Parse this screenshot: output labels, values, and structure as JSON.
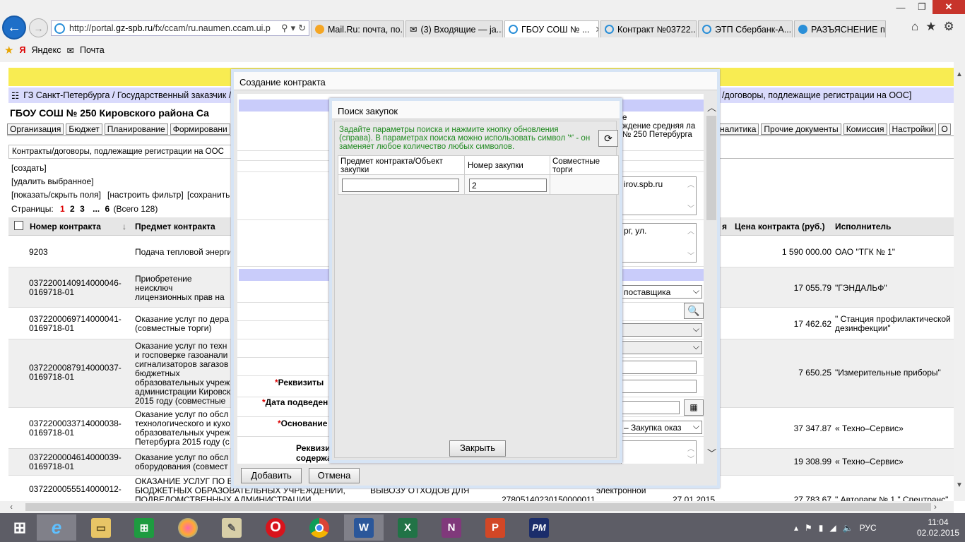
{
  "browser": {
    "url_prefix": "http://portal.",
    "url_domain": "gz-spb.ru",
    "url_rest": "/fx/ccam/ru.naumen.ccam.ui.p",
    "tabs": [
      {
        "label": "Mail.Ru: почта, по...",
        "color": "#f5a623"
      },
      {
        "label": "(3) Входящие — ja...",
        "color": "#444"
      },
      {
        "label": "ГБОУ СОШ № ...",
        "color": "#2a8fd8"
      },
      {
        "label": "Контракт №03722...",
        "color": "#2a8fd8"
      },
      {
        "label": "ЭТП Сбербанк-А...",
        "color": "#2a8fd8"
      },
      {
        "label": "РАЗЪЯСНЕНИЕ п...",
        "color": "#2a8fd8"
      }
    ],
    "favorites": [
      "Яндекс",
      "Почта"
    ]
  },
  "page": {
    "breadcrumb": "ГЗ Санкт-Петербурга / Государственный заказчик /",
    "breadcrumb_right": "/договоры, подлежащие регистрации на ООС]",
    "org_title": "ГБОУ СОШ № 250 Кировского района Са",
    "menu_left": [
      "Организация",
      "Бюджет",
      "Планирование",
      "Формировани"
    ],
    "menu_right": [
      "налитика",
      "Прочие документы",
      "Комиссия",
      "Настройки",
      "О"
    ],
    "subtab": "Контракты/договоры, подлежащие регистрации на ООС",
    "links": {
      "create": "[создать]",
      "delete": "[удалить выбранное]",
      "fields": "[показать/скрыть поля]",
      "filter": "[настроить фильтр]",
      "save": "[сохранить"
    },
    "pager": {
      "label": "Страницы:",
      "p1": "1",
      "p2": "2",
      "p3": "3",
      "ellipsis": "...",
      "last": "6",
      "total": "(Всего 128)"
    },
    "columns": {
      "number": "Номер контракта",
      "subject": "Предмет контракта",
      "extra": "я",
      "price": "Цена контракта (руб.)",
      "executor": "Исполнитель"
    },
    "rows": [
      {
        "number": "9203",
        "subject": "Подача тепловой энерги",
        "price": "1 590 000.00",
        "executor": "ОАО \"ТГК № 1\""
      },
      {
        "number": "0372200140914000046-0169718-01",
        "subject": "Приобретение неисключ лицензионных прав на п (совместные торги)",
        "price": "17 055.79",
        "executor": "\"ГЭНДАЛЬФ\""
      },
      {
        "number": "0372200069714000041-0169718-01",
        "subject": "Оказание услуг по дера (совместные торги)",
        "price": "17 462.62",
        "executor": "\" Станция профилактической дезинфекции\""
      },
      {
        "number": "0372200087914000037-0169718-01",
        "subject": "Оказание услуг по техн и госповерке газоанали сигнализаторов загазов бюджетных образовательных учреж администрации Кировск 2015 году (совместные",
        "price": "7 650.25",
        "executor": "\"Измерительные приборы\""
      },
      {
        "number": "0372200033714000038-0169718-01",
        "subject": "Оказание услуг по обсл технологического и кухо образовательных учреж Петербурга 2015 году (с",
        "price": "37 347.87",
        "executor": "« Техно–Сервис»"
      },
      {
        "number": "0372200004614000039-0169718-01",
        "subject": "Оказание услуг по обсл оборудования (совмест",
        "price": "19 308.99",
        "executor": "« Техно–Сервис»"
      },
      {
        "number": "0372200055514000012-",
        "subject": "ОКАЗАНИЕ УСЛУГ ПО ВЫ ГОСУДАРСТВЕННЫХ БЮДЖЕТНЫХ ОБРАЗОВАТЕЛЬНЫХ УЧРЕЖДЕНИЙ, ПОДВЕДОМСТВЕННЫХ АДМИНИСТРАЦИИ",
        "subject2": "ОКАЗАНИЕ УСЛУГ ПО ВЫВОЗУ ОТХОДОВ ДЛЯ",
        "ident": "27805140230150000011",
        "method": "Аукцион в электронной",
        "date": "27.01.2015",
        "price": "27 783.67",
        "executor": "\" Автопарк № 1 \" Спецтранс\""
      }
    ]
  },
  "dialog_contract": {
    "title": "Создание контракта",
    "org_text": "ждение средняя ла № 250 Петербурга",
    "org_text_prefix": "е",
    "email": "irov.spb.ru",
    "address": "рг, ул.",
    "supplier_select": "поставщика",
    "basis_select": "– Закупка оказ",
    "label_requisites": "Реквизиты",
    "label_date": "Дата подведен",
    "label_basis": "Основание",
    "label_req_content1": "Реквизи",
    "label_req_content2": "содержа",
    "req_mark": "*",
    "add_button": "Добавить",
    "cancel_button": "Отмена"
  },
  "dialog_search": {
    "title": "Поиск закупок",
    "hint": "Задайте параметры поиска и нажмите кнопку обновления (справа). В параметрах поиска можно использовать символ '*' - он заменяет любое количество любых символов.",
    "col_subject": "Предмет контракта/Объект закупки",
    "col_number": "Номер закупки",
    "col_joint": "Совместные торги",
    "subject_value": "",
    "number_value": "2",
    "close_button": "Закрыть"
  },
  "taskbar": {
    "lang": "РУС",
    "time": "11:04",
    "date": "02.02.2015"
  }
}
